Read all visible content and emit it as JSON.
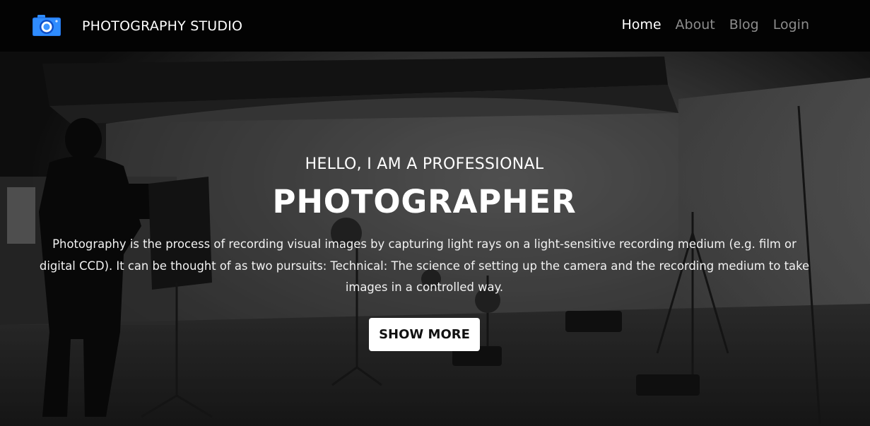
{
  "header": {
    "brand_name": "PHOTOGRAPHY STUDIO",
    "brand_icon": "camera-icon",
    "brand_color": "#2f8cff",
    "nav": [
      {
        "label": "Home",
        "active": true
      },
      {
        "label": "About",
        "active": false
      },
      {
        "label": "Blog",
        "active": false
      },
      {
        "label": "Login",
        "active": false
      }
    ]
  },
  "hero": {
    "kicker": "HELLO, I AM A PROFESSIONAL",
    "title": "PHOTOGRAPHER",
    "description": "Photography is the process of recording visual images by capturing light rays on a light-sensitive recording medium (e.g. film or digital CCD). It can be thought of as two pursuits: Technical: The science of setting up the camera and the recording medium to take images in a controlled way.",
    "button_label": "SHOW MORE",
    "background_theme": "dark photo studio with photographer silhouette and lighting stands"
  }
}
